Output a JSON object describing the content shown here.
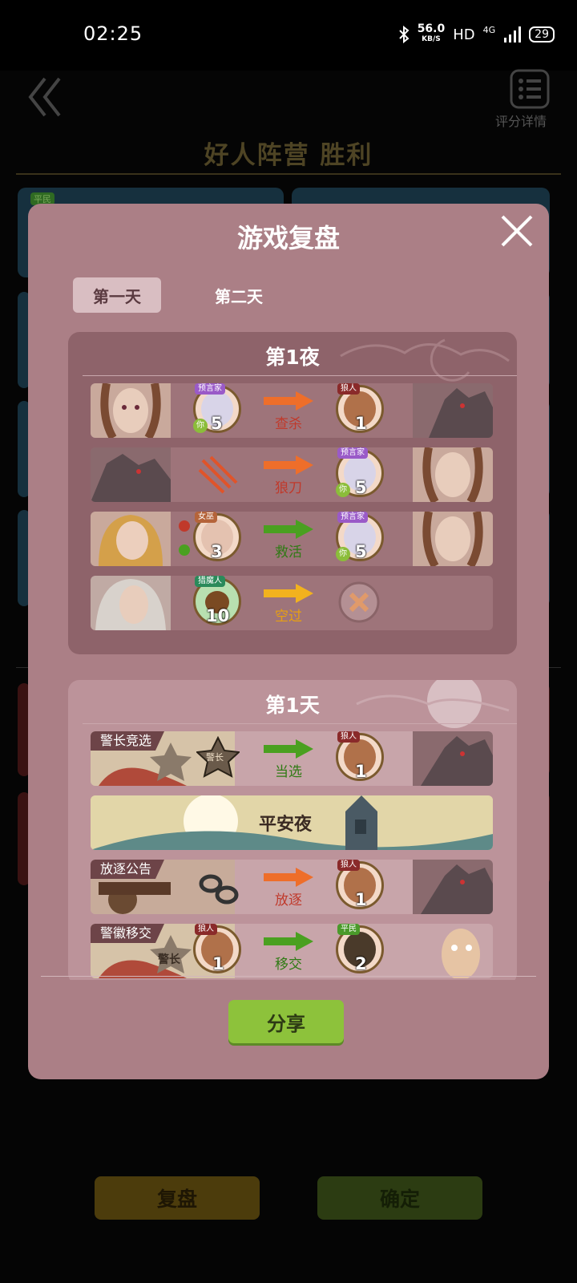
{
  "status_bar": {
    "time": "02:25",
    "speed_value": "56.0",
    "speed_unit": "KB/S",
    "hd": "HD",
    "network": "4G",
    "battery": "29"
  },
  "header": {
    "rating_label": "评分详情",
    "result_title": "好人阵营  胜利"
  },
  "background_cards": {
    "badge": "平民"
  },
  "bottom_buttons": {
    "replay": "复盘",
    "confirm": "确定"
  },
  "modal": {
    "title": "游戏复盘",
    "tabs": [
      {
        "label": "第一天",
        "active": true
      },
      {
        "label": "第二天",
        "active": false
      }
    ],
    "share_label": "分享",
    "night": {
      "title": "第1夜",
      "rows": [
        {
          "actor_role": "预言家",
          "actor_seat": "5",
          "actor_you": "你",
          "action": "查杀",
          "arrow_color": "#ee6e2a",
          "target_role": "狼人",
          "target_seat": "1"
        },
        {
          "action": "狼刀",
          "arrow_color": "#ee6e2a",
          "target_role": "预言家",
          "target_seat": "5",
          "target_you": "你"
        },
        {
          "actor_role": "女巫",
          "actor_seat": "3",
          "action": "救活",
          "arrow_color": "#4aa020",
          "target_role": "预言家",
          "target_seat": "5",
          "target_you": "你"
        },
        {
          "actor_role": "猎魔人",
          "actor_seat": "10",
          "action": "空过",
          "arrow_color": "#f2b21e"
        }
      ]
    },
    "day": {
      "title": "第1天",
      "rows": [
        {
          "tag": "警长竞选",
          "badge_text": "警长",
          "action": "当选",
          "arrow_color": "#4aa020",
          "target_role": "狼人",
          "target_seat": "1"
        },
        {
          "banner": "平安夜"
        },
        {
          "tag": "放逐公告",
          "action": "放逐",
          "arrow_color": "#ee6e2a",
          "target_role": "狼人",
          "target_seat": "1"
        },
        {
          "tag": "警徽移交",
          "badge_text": "警长",
          "actor_role": "狼人",
          "actor_seat": "1",
          "action": "移交",
          "arrow_color": "#4aa020",
          "target_role": "平民",
          "target_seat": "2"
        }
      ]
    }
  }
}
